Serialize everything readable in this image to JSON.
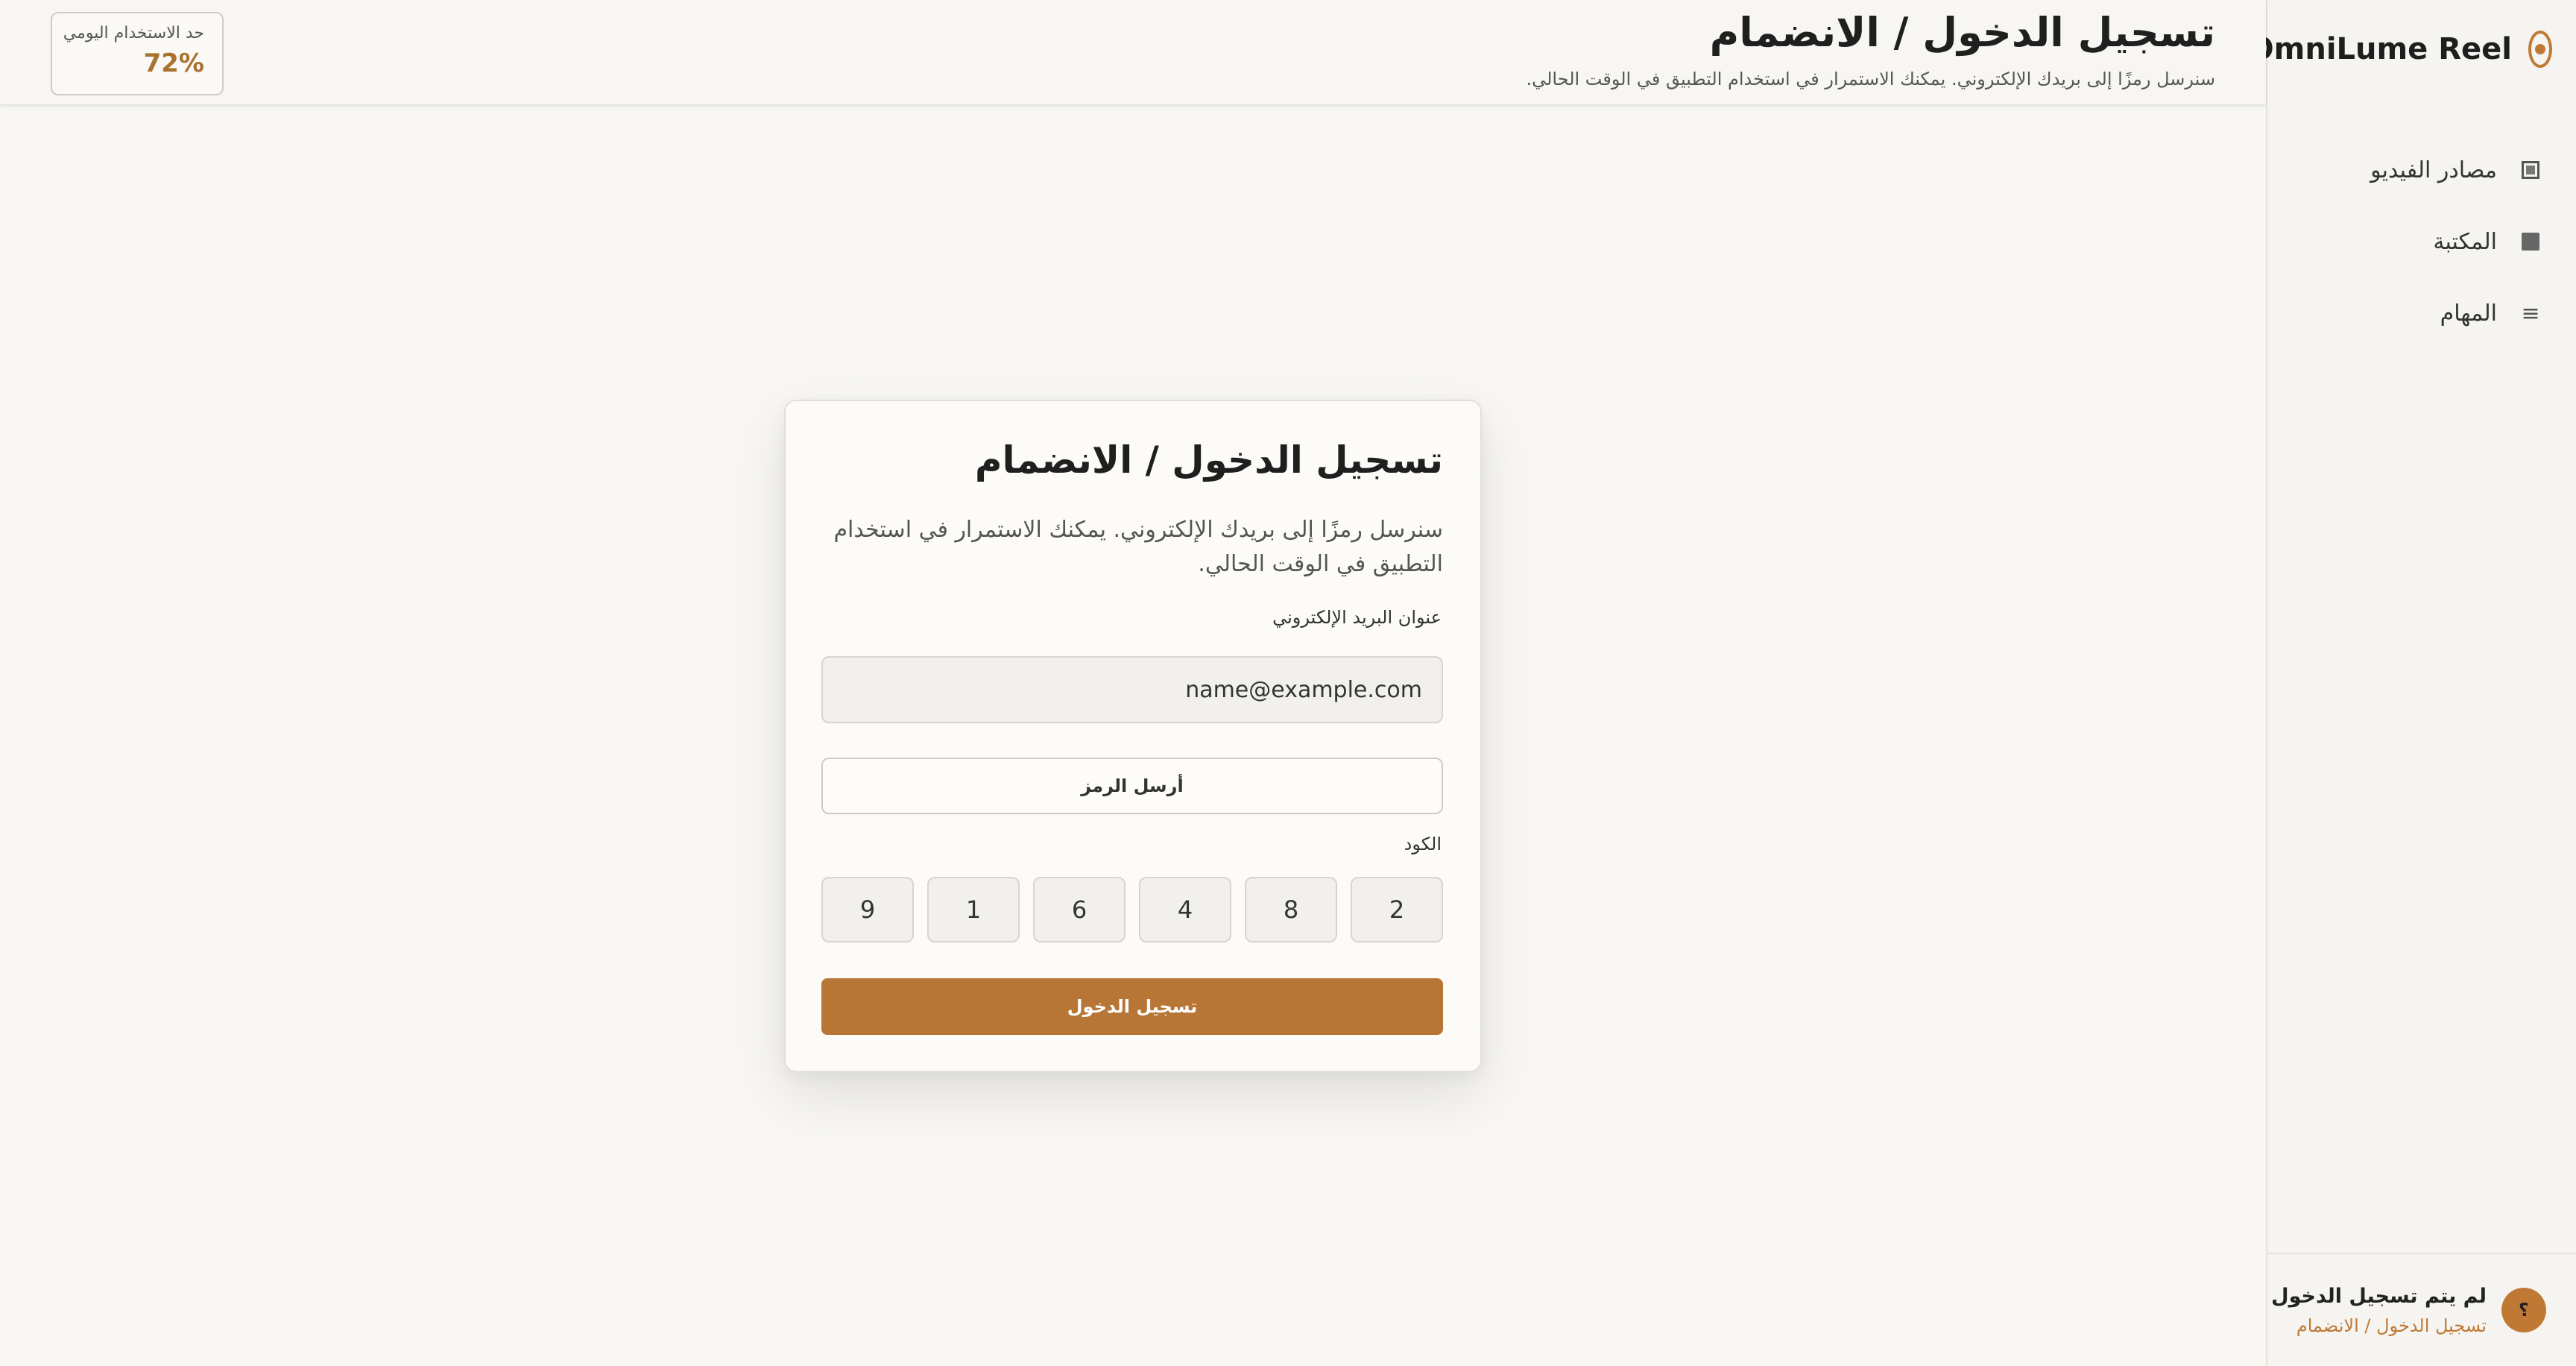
{
  "app": {
    "name": "OmniLume Reel"
  },
  "sidebar": {
    "items": [
      {
        "label": "مصادر الفيديو",
        "icon": "video-sources-icon"
      },
      {
        "label": "المكتبة",
        "icon": "library-icon"
      },
      {
        "label": "المهام",
        "icon": "tasks-icon"
      }
    ],
    "footer": {
      "avatar_text": "؟",
      "status": "لم يتم تسجيل الدخول",
      "link": "تسجيل الدخول / الانضمام"
    }
  },
  "header": {
    "title": "تسجيل الدخول / الانضمام",
    "subtitle": "سنرسل رمزًا إلى بريدك الإلكتروني. يمكنك الاستمرار في استخدام التطبيق في الوقت الحالي.",
    "usage": {
      "label": "حد الاستخدام اليومي",
      "value": "72%"
    }
  },
  "card": {
    "title": "تسجيل الدخول / الانضمام",
    "description": "سنرسل رمزًا إلى بريدك الإلكتروني. يمكنك الاستمرار في استخدام التطبيق في الوقت الحالي.",
    "email_label": "عنوان البريد الإلكتروني",
    "email_value": "name@example.com",
    "send_code_label": "أرسل الرمز",
    "code_label": "الكود",
    "code_digits": [
      "2",
      "8",
      "4",
      "6",
      "1",
      "9"
    ],
    "login_label": "تسجيل الدخول"
  },
  "colors": {
    "accent": "#b77536",
    "background": "#f8f7f3"
  }
}
